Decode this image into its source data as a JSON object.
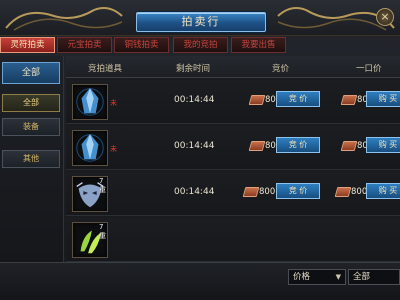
{
  "window": {
    "title": "拍卖行",
    "close_label": "×"
  },
  "tabs": [
    {
      "label": "灵符拍卖",
      "active": true
    },
    {
      "label": "元宝拍卖",
      "active": false
    },
    {
      "label": "铜钱拍卖",
      "active": false
    },
    {
      "label": "我的竞拍",
      "active": false
    },
    {
      "label": "我要出售",
      "active": false
    }
  ],
  "sidebar": {
    "all_label": "全部",
    "items": [
      {
        "label": "全部",
        "active": true
      },
      {
        "label": "装备",
        "active": false
      },
      {
        "label": "其他",
        "active": false
      }
    ]
  },
  "list": {
    "headers": {
      "item": "竞拍道具",
      "time": "剩余时间",
      "bid": "竞价",
      "buy": "一口价"
    },
    "rows": [
      {
        "icon": "blue-crystal-icon",
        "count": "",
        "mark": "未",
        "time": "00:14:44",
        "bid_price": "80",
        "bid_label": "竞 价",
        "buy_price": "80",
        "buy_label": "购 买"
      },
      {
        "icon": "blue-crystal-icon",
        "count": "",
        "mark": "未",
        "time": "00:14:44",
        "bid_price": "80",
        "bid_label": "竞 价",
        "buy_price": "80",
        "buy_label": "购 买"
      },
      {
        "icon": "silver-mask-icon",
        "count": "7重",
        "mark": "",
        "time": "00:14:44",
        "bid_price": "800",
        "bid_label": "竞 价",
        "buy_price": "800",
        "buy_label": "购 买"
      },
      {
        "icon": "green-leaf-icon",
        "count": "7重",
        "mark": "",
        "time": "",
        "bid_price": "",
        "bid_label": "",
        "buy_price": "",
        "buy_label": ""
      }
    ]
  },
  "filters": {
    "sort": {
      "value": "价格"
    },
    "category": {
      "value": "全部"
    }
  },
  "colors": {
    "accent_blue": "#2f7fc1",
    "tab_red": "#c8403a",
    "gold_text": "#d5b866"
  }
}
